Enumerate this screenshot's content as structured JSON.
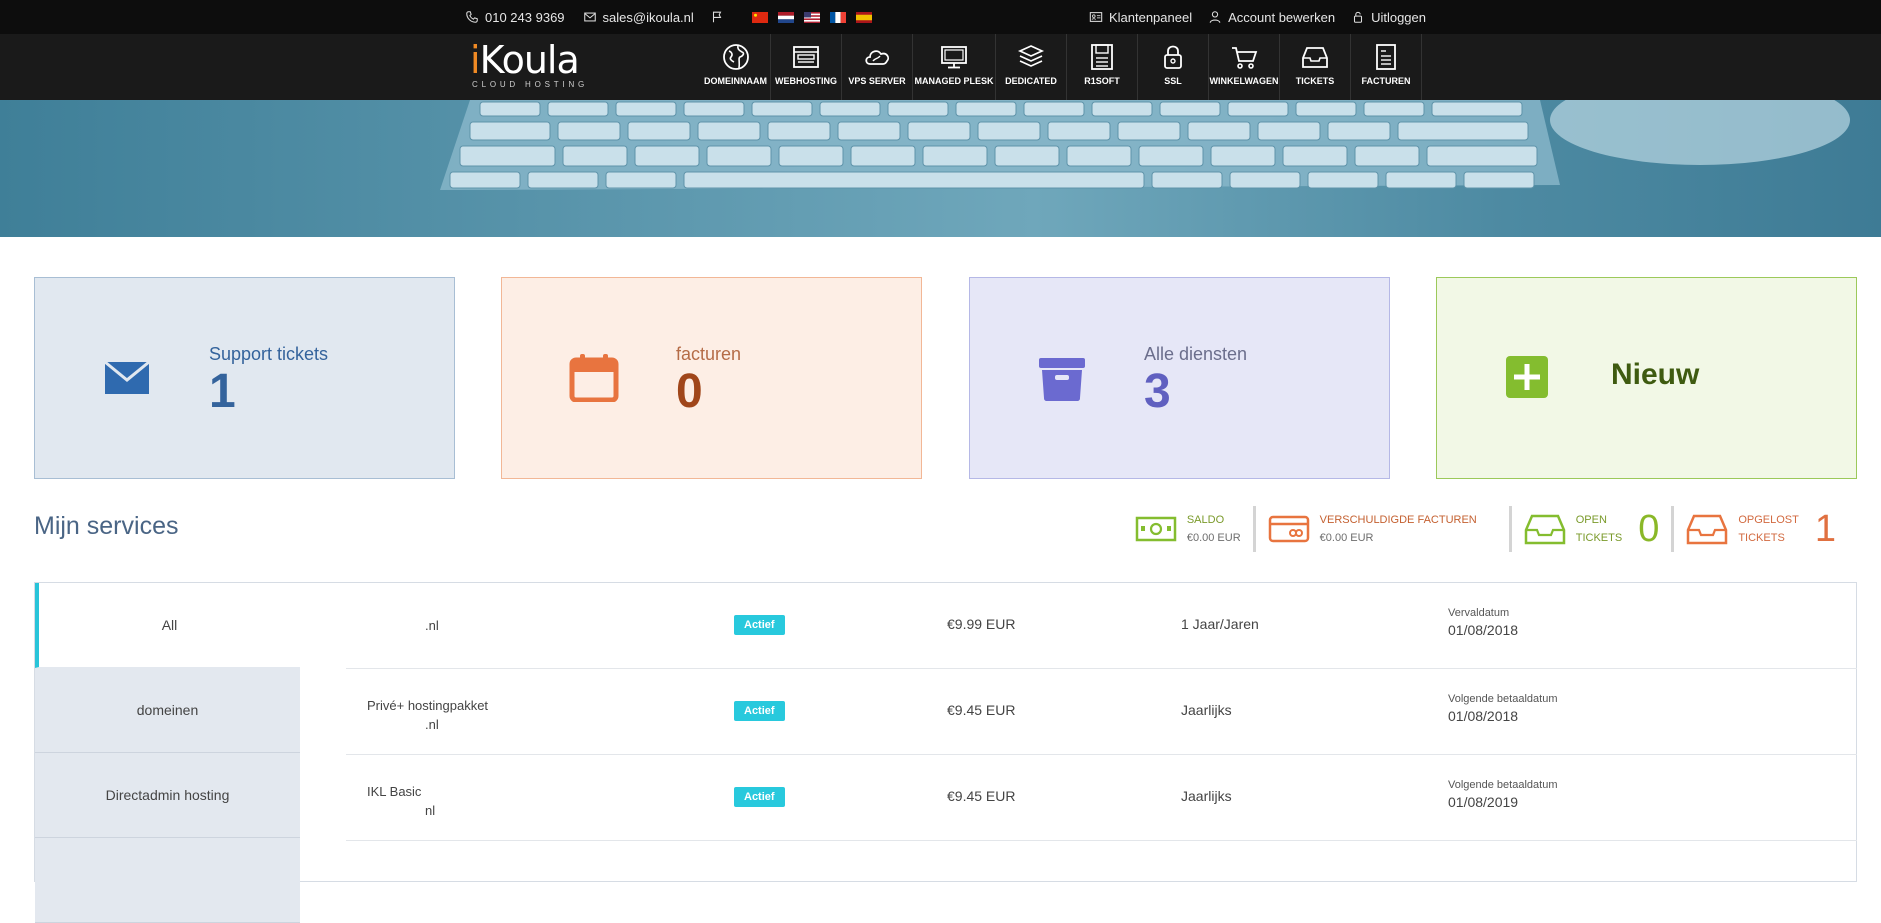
{
  "topbar": {
    "phone": "010 243 9369",
    "email": "sales@ikoula.nl",
    "flags": [
      "cn",
      "nl",
      "us",
      "fr",
      "es"
    ],
    "client_panel": "Klantenpaneel",
    "edit_account": "Account bewerken",
    "logout": "Uitloggen"
  },
  "logo": {
    "word_i": "i",
    "word_rest": "Koula",
    "tagline": "CLOUD HOSTING"
  },
  "nav": [
    {
      "label": "DOMEINNAAM",
      "icon": "globe-icon"
    },
    {
      "label": "WEBHOSTING",
      "icon": "browser-window-icon"
    },
    {
      "label": "VPS SERVER",
      "icon": "cloud-icon"
    },
    {
      "label": "MANAGED PLESK",
      "icon": "monitor-icon"
    },
    {
      "label": "DEDICATED",
      "icon": "server-stack-icon"
    },
    {
      "label": "R1SOFT",
      "icon": "floppy-disk-icon"
    },
    {
      "label": "SSL",
      "icon": "padlock-icon"
    },
    {
      "label": "WINKELWAGEN",
      "icon": "shopping-cart-icon"
    },
    {
      "label": "TICKETS",
      "icon": "inbox-tray-icon"
    },
    {
      "label": "FACTUREN",
      "icon": "invoice-document-icon"
    }
  ],
  "cards": {
    "tickets": {
      "label": "Support tickets",
      "count": "1"
    },
    "invoices": {
      "label": "facturen",
      "count": "0"
    },
    "services": {
      "label": "Alle diensten",
      "count": "3"
    },
    "new": {
      "label": "Nieuw"
    }
  },
  "services_title": "Mijn services",
  "stats": {
    "saldo": {
      "label": "SALDO",
      "value": "€0.00 EUR"
    },
    "due": {
      "label": "VERSCHULDIGDE FACTUREN",
      "value": "€0.00 EUR"
    },
    "open": {
      "line1": "OPEN",
      "line2": "TICKETS",
      "count": "0"
    },
    "solved": {
      "line1": "OPGELOST",
      "line2": "TICKETS",
      "count": "1"
    }
  },
  "tabs": [
    "All",
    "domeinen",
    "Directadmin hosting",
    ""
  ],
  "services": [
    {
      "name": "",
      "domain": ".nl",
      "status": "Actief",
      "price": "€9.99 EUR",
      "cycle": "1 Jaar/Jaren",
      "date_label": "Vervaldatum",
      "date": "01/08/2018"
    },
    {
      "name": "Privé+ hostingpakket",
      "domain": ".nl",
      "status": "Actief",
      "price": "€9.45 EUR",
      "cycle": "Jaarlijks",
      "date_label": "Volgende betaaldatum",
      "date": "01/08/2018"
    },
    {
      "name": "IKL Basic",
      "domain": "nl",
      "status": "Actief",
      "price": "€9.45 EUR",
      "cycle": "Jaarlijks",
      "date_label": "Volgende betaaldatum",
      "date": "01/08/2019"
    }
  ],
  "colors": {
    "accent": "#28c4d9",
    "ticket_blue": "#34639c",
    "invoice_orange": "#e8743f",
    "services_purple": "#6060c0",
    "new_green": "#84bd2f"
  }
}
